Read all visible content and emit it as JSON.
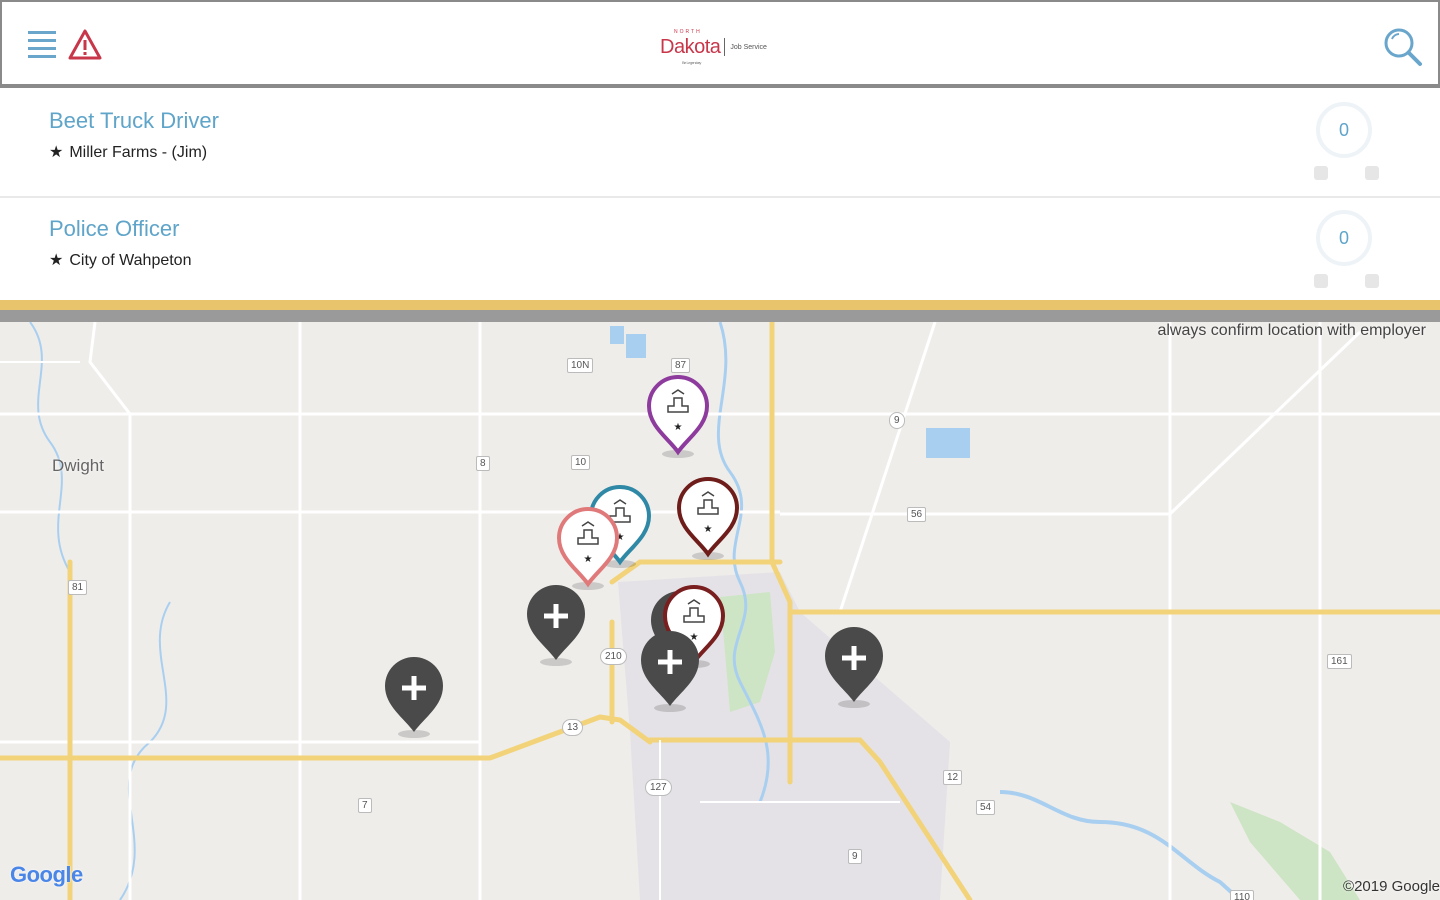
{
  "header": {
    "logo": {
      "top": "NORTH",
      "main": "Dakota",
      "bottom": "Be Legendary",
      "sub": "Job Service"
    }
  },
  "jobs": [
    {
      "title": "Beet Truck Driver",
      "employer": "Miller Farms - (Jim)",
      "count": "0"
    },
    {
      "title": "Police Officer",
      "employer": "City of Wahpeton",
      "count": "0"
    }
  ],
  "map": {
    "note": "always confirm location with employer",
    "places": {
      "dwight": "Dwight"
    },
    "routes": [
      "10N",
      "87",
      "9",
      "8",
      "10",
      "56",
      "81",
      "210",
      "13",
      "127",
      "161",
      "12",
      "7",
      "54",
      "9",
      "110"
    ],
    "attribution": "Google",
    "copyright": "©2019 Google"
  },
  "colors": {
    "accent": "#5fa4c9",
    "brand": "#c8364a",
    "gold_bar": "#e8c46c"
  },
  "icons": {
    "star": "★"
  }
}
